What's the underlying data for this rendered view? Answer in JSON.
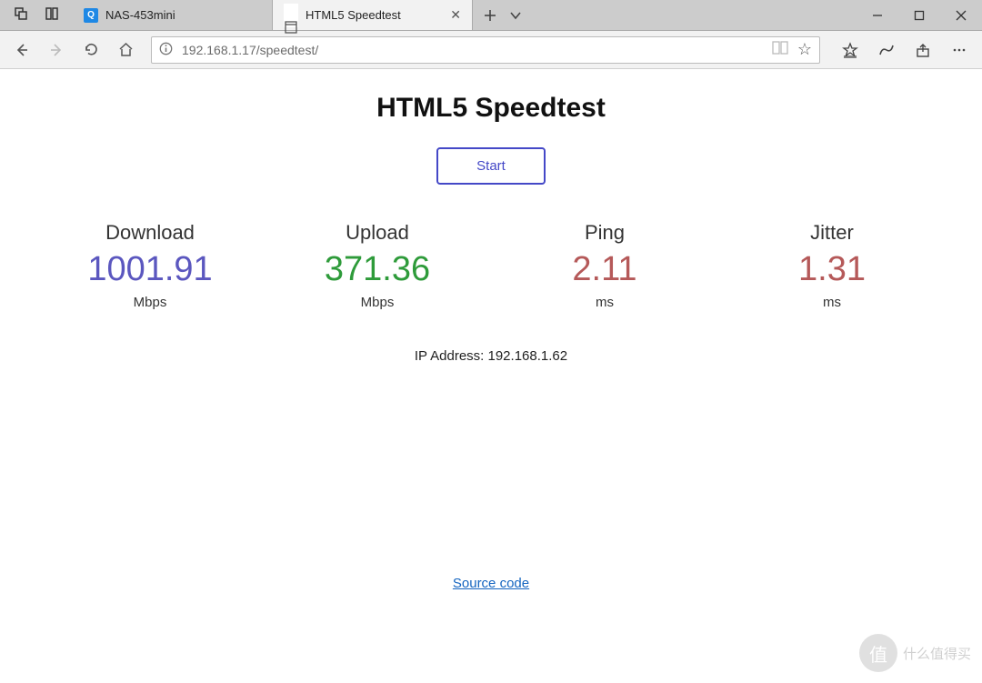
{
  "titlebar": {
    "tabs": [
      {
        "icon": "qnap",
        "label": "NAS-453mini",
        "active": false,
        "close": false
      },
      {
        "icon": "page",
        "label": "HTML5 Speedtest",
        "active": true,
        "close": true
      }
    ]
  },
  "addressbar": {
    "url": "192.168.1.17/speedtest/"
  },
  "page": {
    "title": "HTML5 Speedtest",
    "start_button": "Start",
    "metrics": {
      "download": {
        "label": "Download",
        "value": "1001.91",
        "unit": "Mbps"
      },
      "upload": {
        "label": "Upload",
        "value": "371.36",
        "unit": "Mbps"
      },
      "ping": {
        "label": "Ping",
        "value": "2.11",
        "unit": "ms"
      },
      "jitter": {
        "label": "Jitter",
        "value": "1.31",
        "unit": "ms"
      }
    },
    "ip_label": "IP Address: ",
    "ip_value": "192.168.1.62",
    "source_link": "Source code"
  },
  "watermark": {
    "glyph": "值",
    "text": "什么值得买"
  }
}
